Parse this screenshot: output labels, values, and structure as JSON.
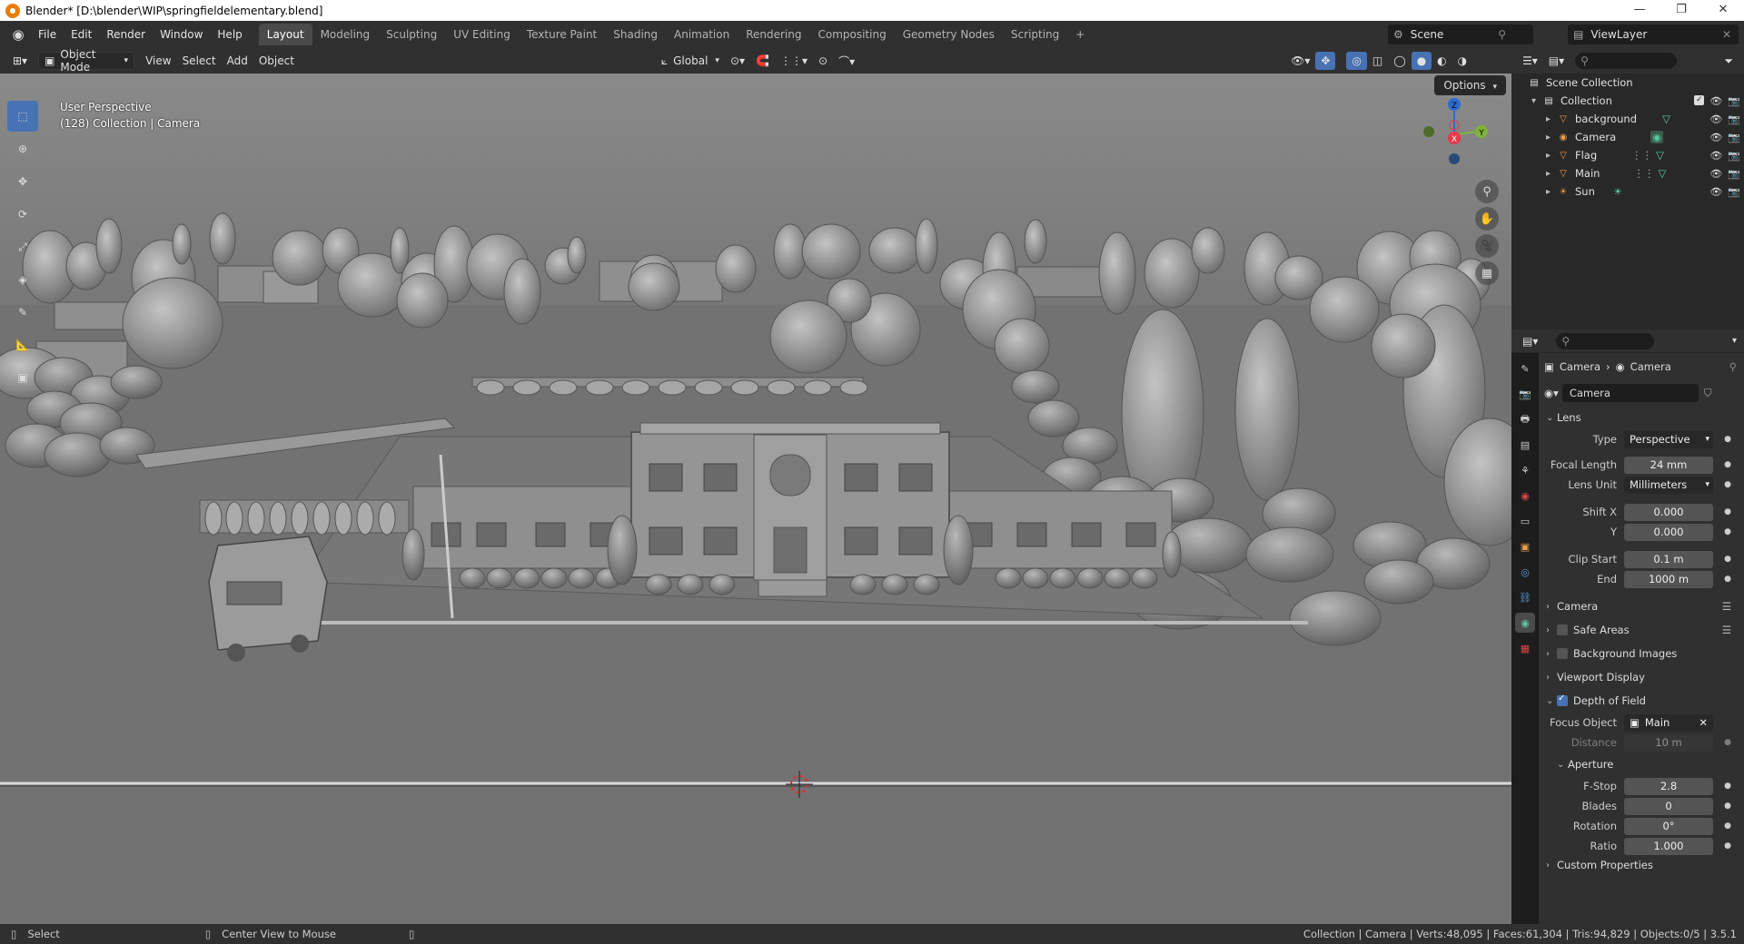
{
  "window": {
    "title": "Blender* [D:\\blender\\WIP\\springfieldelementary.blend]",
    "controls": [
      "—",
      "❐",
      "✕"
    ]
  },
  "menu": [
    "File",
    "Edit",
    "Render",
    "Window",
    "Help"
  ],
  "workspaces": [
    {
      "label": "Layout",
      "active": true
    },
    {
      "label": "Modeling"
    },
    {
      "label": "Sculpting"
    },
    {
      "label": "UV Editing"
    },
    {
      "label": "Texture Paint"
    },
    {
      "label": "Shading"
    },
    {
      "label": "Animation"
    },
    {
      "label": "Rendering"
    },
    {
      "label": "Compositing"
    },
    {
      "label": "Geometry Nodes"
    },
    {
      "label": "Scripting"
    }
  ],
  "add_workspace": "+",
  "scene": {
    "label": "Scene"
  },
  "view_layer": {
    "label": "ViewLayer"
  },
  "viewport_header": {
    "mode": "Object Mode",
    "menus": [
      "View",
      "Select",
      "Add",
      "Object"
    ],
    "transform_orientation": "Global",
    "options": "Options"
  },
  "viewport": {
    "perspective": "User Perspective",
    "collection_info": "(128) Collection | Camera",
    "background_color": "#767676",
    "gizmo_axes": {
      "z": "Z",
      "y": "Y",
      "x": "X"
    }
  },
  "tools": [
    {
      "name": "select-box-tool",
      "glyph": "⬚",
      "active": true
    },
    {
      "name": "cursor-tool",
      "glyph": "⊕"
    },
    {
      "name": "move-tool",
      "glyph": "✥"
    },
    {
      "name": "rotate-tool",
      "glyph": "⟳"
    },
    {
      "name": "scale-tool",
      "glyph": "⤢"
    },
    {
      "name": "transform-tool",
      "glyph": "◈"
    },
    {
      "name": "annotate-tool",
      "glyph": "✎"
    },
    {
      "name": "measure-tool",
      "glyph": "📐"
    },
    {
      "name": "add-cube-tool",
      "glyph": "▣"
    }
  ],
  "outliner": {
    "root": "Scene Collection",
    "collection": "Collection",
    "items": [
      {
        "label": "background",
        "icon": "▽",
        "color": "#e8a04a"
      },
      {
        "label": "Camera",
        "icon": "◉",
        "color": "#e8a04a"
      },
      {
        "label": "Flag",
        "icon": "▽",
        "color": "#e8a04a"
      },
      {
        "label": "Main",
        "icon": "▽",
        "color": "#e8a04a"
      },
      {
        "label": "Sun",
        "icon": "☀",
        "color": "#e8a04a"
      }
    ]
  },
  "properties": {
    "breadcrumb": [
      "Camera",
      "Camera"
    ],
    "data_name": "Camera",
    "lens": {
      "section": "Lens",
      "type_label": "Type",
      "type_value": "Perspective",
      "focal_label": "Focal Length",
      "focal_value": "24 mm",
      "unit_label": "Lens Unit",
      "unit_value": "Millimeters",
      "shiftx_label": "Shift X",
      "shiftx_value": "0.000",
      "shifty_label": "Y",
      "shifty_value": "0.000",
      "clipstart_label": "Clip Start",
      "clipstart_value": "0.1 m",
      "clipend_label": "End",
      "clipend_value": "1000 m"
    },
    "sections": {
      "camera": "Camera",
      "safe_areas": "Safe Areas",
      "background_images": "Background Images",
      "viewport_display": "Viewport Display",
      "dof": "Depth of Field",
      "aperture": "Aperture",
      "custom": "Custom Properties"
    },
    "dof": {
      "focus_label": "Focus Object",
      "focus_value": "Main",
      "distance_label": "Distance",
      "distance_value": "10 m"
    },
    "aperture": {
      "fstop_label": "F-Stop",
      "fstop_value": "2.8",
      "blades_label": "Blades",
      "blades_value": "0",
      "rotation_label": "Rotation",
      "rotation_value": "0°",
      "ratio_label": "Ratio",
      "ratio_value": "1.000"
    }
  },
  "status": {
    "left1": "Select",
    "left2": "Center View to Mouse",
    "right": "Collection | Camera | Verts:48,095 | Faces:61,304 | Tris:94,829 | Objects:0/5 | 3.5.1"
  },
  "colors": {
    "accent": "#4772b3",
    "header": "#303030",
    "panel": "#282828"
  }
}
